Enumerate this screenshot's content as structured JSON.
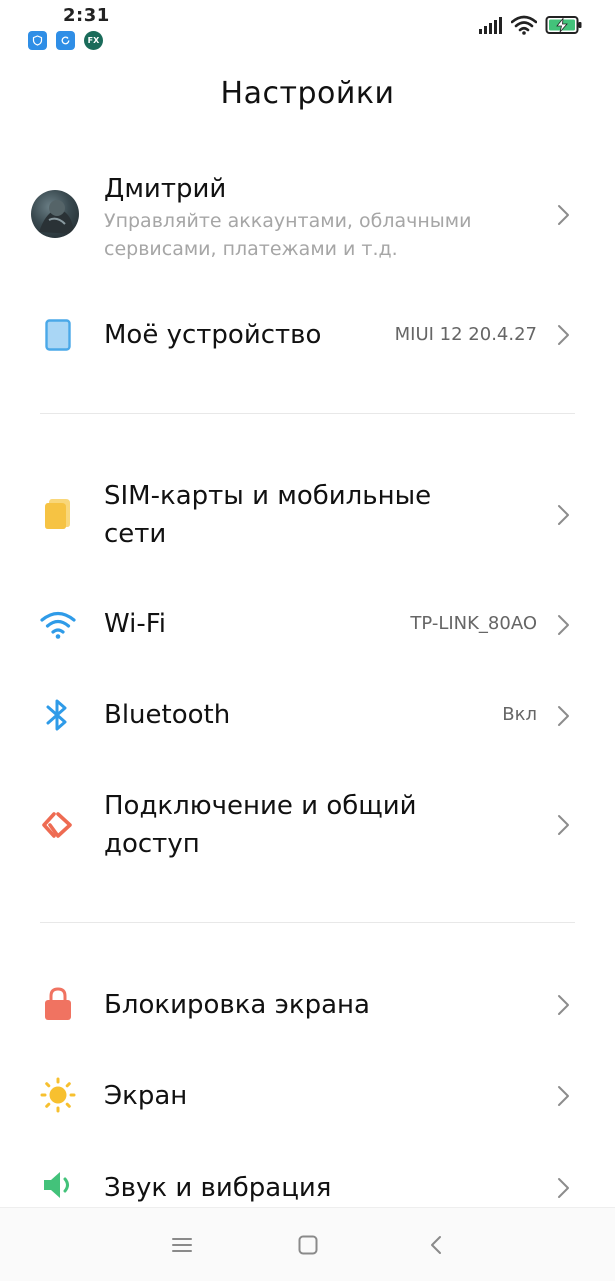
{
  "status_bar": {
    "time": "2:31",
    "notification_icons": [
      "app-shield-icon",
      "app-refresh-icon",
      "fx-file-explorer-icon"
    ],
    "fx_label": "FX",
    "system_icons": [
      "signal-icon",
      "wifi-icon",
      "battery-charging-icon"
    ]
  },
  "header": {
    "title": "Настройки"
  },
  "account": {
    "name": "Дмитрий",
    "subtitle_line1": "Управляйте аккаунтами, облачными",
    "subtitle_line2": "сервисами, платежами и т.д."
  },
  "device": {
    "label": "Моё устройство",
    "value": "MIUI 12 20.4.27",
    "icon": "phone-icon"
  },
  "network_items": [
    {
      "label_line1": "SIM-карты и мобильные",
      "label_line2": "сети",
      "value": "",
      "icon": "sim-card-icon"
    },
    {
      "label_line1": "Wi-Fi",
      "label_line2": "",
      "value": "TP-LINK_80AO",
      "icon": "wifi-icon"
    },
    {
      "label_line1": "Bluetooth",
      "label_line2": "",
      "value": "Вкл",
      "icon": "bluetooth-icon"
    },
    {
      "label_line1": "Подключение и общий",
      "label_line2": "доступ",
      "value": "",
      "icon": "connection-sharing-icon"
    }
  ],
  "system_items": [
    {
      "label": "Блокировка экрана",
      "icon": "lock-icon"
    },
    {
      "label": "Экран",
      "icon": "brightness-icon"
    },
    {
      "label": "Звук и вибрация",
      "icon": "speaker-icon"
    }
  ],
  "nav_bar": [
    "menu-icon",
    "home-icon",
    "back-icon"
  ],
  "colors": {
    "device_icon": "#4aa8e8",
    "sim_icon": "#f6c343",
    "wifi_icon": "#2f9be8",
    "bluetooth_icon": "#2f9be8",
    "connection_icon": "#ee6b52",
    "lock_icon": "#f07361",
    "brightness_icon": "#f7c02f",
    "sound_icon": "#43c27a"
  }
}
